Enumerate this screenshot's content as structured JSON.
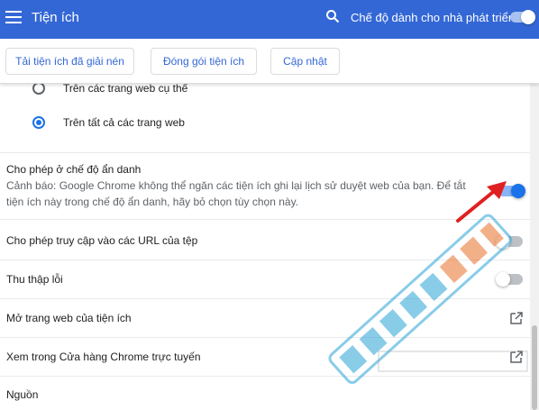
{
  "header": {
    "title": "Tiện ích",
    "menu_icon": "hamburger-menu-icon",
    "search_icon": "search-icon",
    "developer_mode_label": "Chế độ dành cho nhà phát triển",
    "developer_mode_on": true
  },
  "toolbar": {
    "load_unpacked": "Tải tiện ích đã giải nén",
    "pack_extension": "Đóng gói tiện ích",
    "update": "Cập nhật"
  },
  "site_access": {
    "options": [
      {
        "label": "Trên các trang web cụ thể",
        "selected": false
      },
      {
        "label": "Trên tất cả các trang web",
        "selected": true
      }
    ]
  },
  "settings": {
    "incognito": {
      "title": "Cho phép ở chế độ ẩn danh",
      "warning": "Cảnh báo: Google Chrome không thể ngăn các tiện ích ghi lại lịch sử duyệt web của bạn. Để tắt tiện ích này trong chế độ ẩn danh, hãy bỏ chọn tùy chọn này.",
      "enabled": true
    },
    "file_urls": {
      "title": "Cho phép truy cập vào các URL của tệp",
      "enabled": false
    },
    "collect_errors": {
      "title": "Thu thập lỗi",
      "enabled": false
    },
    "open_site": {
      "title": "Mở trang web của tiện ích",
      "icon": "open-in-new-icon"
    },
    "view_store": {
      "title": "Xem trong Cửa hàng Chrome trực tuyến",
      "icon": "open-in-new-icon"
    },
    "source": {
      "title": "Nguồn"
    }
  },
  "colors": {
    "header_bg": "#3367d6",
    "accent": "#1a73e8",
    "annotation_arrow": "#e02020"
  }
}
